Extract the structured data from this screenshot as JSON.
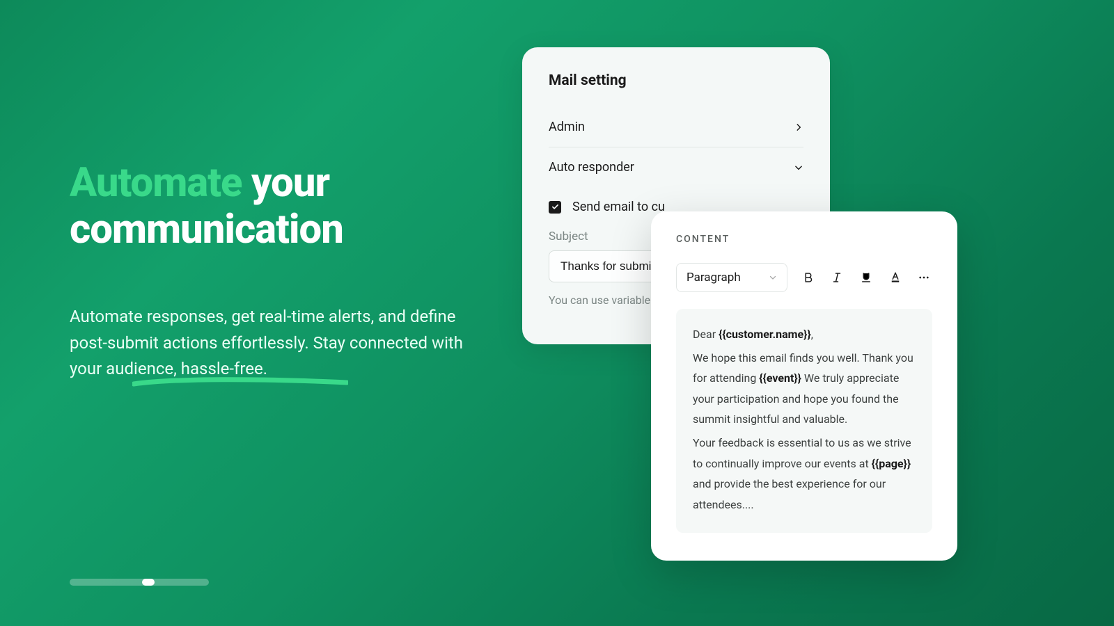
{
  "hero": {
    "accent": "Automate",
    "rest1": " your",
    "line2": "communication",
    "sub": "Automate responses, get real-time alerts, and define post-submit actions effortlessly. Stay connected with your audience, hassle-free."
  },
  "mail": {
    "title": "Mail setting",
    "admin": "Admin",
    "auto": "Auto responder",
    "send_label": "Send email to cu",
    "subject_label": "Subject",
    "subject_value": "Thanks for submitt",
    "helper": "You can use variable dynamic content."
  },
  "content": {
    "label": "CONTENT",
    "style": "Paragraph",
    "line1_a": "Dear ",
    "line1_b": "{{customer.name}}",
    "line1_c": ",",
    "line2_a": "We hope this email finds you well. Thank you for attending ",
    "line2_b": "{{event}}",
    "line2_c": " We truly appreciate your participation and hope you found the summit insightful and valuable.",
    "line3_a": "Your feedback is essential to us as we strive to continually improve our events at ",
    "line3_b": "{{page}}",
    "line3_c": " and provide the best experience for our attendees...."
  }
}
